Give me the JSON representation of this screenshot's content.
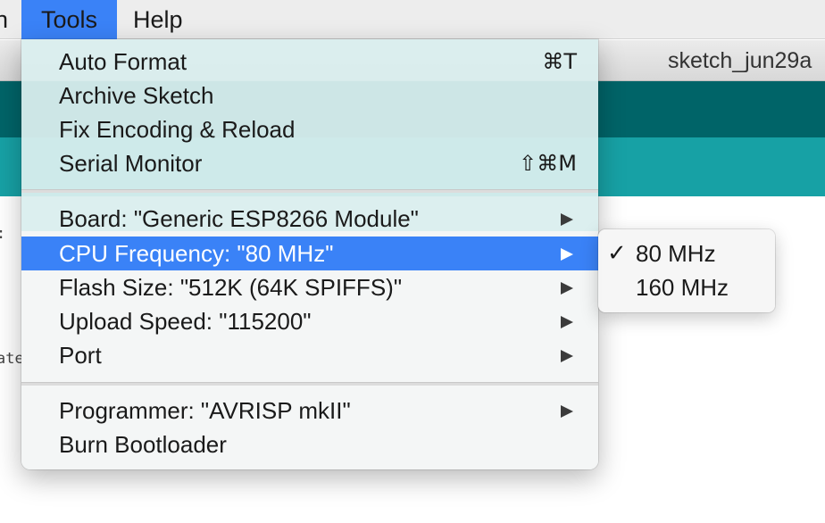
{
  "menubar": {
    "partial_left": "n",
    "tools": "Tools",
    "help": "Help"
  },
  "window": {
    "title": "sketch_jun29a",
    "code_fragments": [
      ":",
      "ate"
    ]
  },
  "tools_menu": {
    "items": [
      {
        "label": "Auto Format",
        "shortcut": "⌘T"
      },
      {
        "label": "Archive Sketch",
        "shortcut": ""
      },
      {
        "label": "Fix Encoding & Reload",
        "shortcut": ""
      },
      {
        "label": "Serial Monitor",
        "shortcut": "⇧⌘M"
      },
      {
        "label": "Board: \"Generic ESP8266 Module\"",
        "submenu": true
      },
      {
        "label": "CPU Frequency: \"80 MHz\"",
        "submenu": true,
        "highlighted": true
      },
      {
        "label": "Flash Size: \"512K (64K SPIFFS)\"",
        "submenu": true
      },
      {
        "label": "Upload Speed: \"115200\"",
        "submenu": true
      },
      {
        "label": "Port",
        "submenu": true
      },
      {
        "label": "Programmer: \"AVRISP mkII\"",
        "submenu": true
      },
      {
        "label": "Burn Bootloader",
        "shortcut": ""
      }
    ]
  },
  "cpu_frequency_submenu": {
    "items": [
      {
        "label": "80 MHz",
        "checked": true,
        "check_mark": "✓"
      },
      {
        "label": "160 MHz",
        "checked": false,
        "check_mark": ""
      }
    ]
  },
  "colors": {
    "highlight": "#3a82f7",
    "toolbar_teal": "#006468",
    "tabbar_teal": "#17a1a5"
  },
  "icons": {
    "submenu_arrow": "triangle-right-icon",
    "check": "checkmark-icon"
  }
}
